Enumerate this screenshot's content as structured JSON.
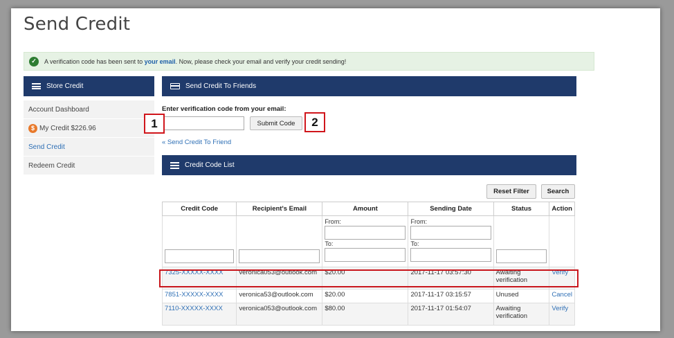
{
  "page": {
    "title": "Send Credit"
  },
  "alert": {
    "prefix": "A verification code has been sent to",
    "link": "your email",
    "suffix": ". Now, please check your email and verify your credit sending!"
  },
  "sidebar": {
    "header": "Store Credit",
    "items": [
      {
        "label": "Account Dashboard"
      },
      {
        "label": "My Credit $226.96",
        "icon": "$"
      },
      {
        "label": "Send Credit"
      },
      {
        "label": "Redeem Credit"
      }
    ]
  },
  "send_section": {
    "header": "Send Credit To Friends"
  },
  "verify": {
    "label": "Enter verification code from your email:",
    "input_value": "",
    "submit_label": "Submit Code"
  },
  "callouts": [
    "1",
    "2"
  ],
  "back_link": "« Send Credit To Friend",
  "list_section": {
    "header": "Credit Code List"
  },
  "buttons": {
    "reset": "Reset Filter",
    "search": "Search"
  },
  "table": {
    "columns": [
      "Credit Code",
      "Recipient's Email",
      "Amount",
      "Sending Date",
      "Status",
      "Action"
    ],
    "filter": {
      "from": "From:",
      "to": "To:"
    },
    "rows": [
      {
        "code": "7325-XXXXX-XXXX",
        "email": "veronica053@outlook.com",
        "amount": "$20.00",
        "date": "2017-11-17 03:57:30",
        "status": "Awaiting verification",
        "action": "Verify"
      },
      {
        "code": "7851-XXXXX-XXXX",
        "email": "veronica53@outlook.com",
        "amount": "$20.00",
        "date": "2017-11-17 03:15:57",
        "status": "Unused",
        "action": "Cancel"
      },
      {
        "code": "7110-XXXXX-XXXX",
        "email": "veronica053@outlook.com",
        "amount": "$80.00",
        "date": "2017-11-17 01:54:07",
        "status": "Awaiting verification",
        "action": "Verify"
      }
    ]
  },
  "colors": {
    "navy": "#1f3a6b",
    "link": "#2e6fb5",
    "callout_red": "#d0151b",
    "alert_bg": "#e6f2e4"
  }
}
